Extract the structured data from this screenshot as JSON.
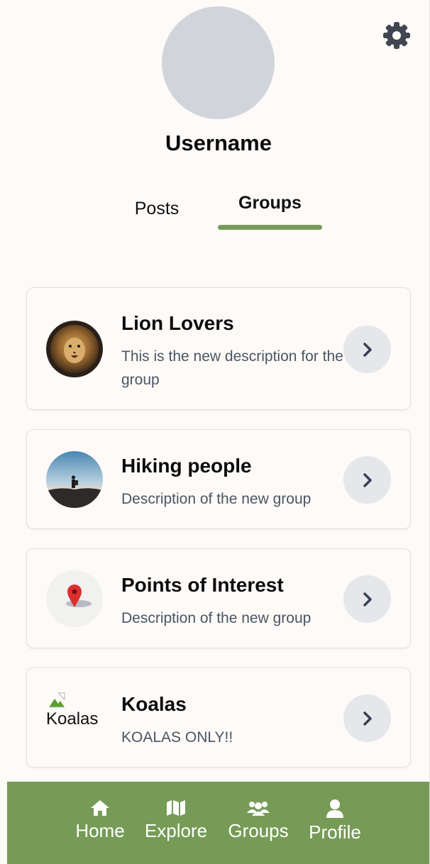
{
  "profile": {
    "username": "Username"
  },
  "tabs": [
    {
      "label": "Posts",
      "active": false
    },
    {
      "label": "Groups",
      "active": true
    }
  ],
  "groups": [
    {
      "name": "Lion Lovers",
      "description": "This is the new description for the group",
      "thumbnail": "lion-photo"
    },
    {
      "name": "Hiking people",
      "description": "Description of the new group",
      "thumbnail": "hiker-photo"
    },
    {
      "name": "Points of Interest",
      "description": "Description of the new group",
      "thumbnail": "map-pin-icon"
    },
    {
      "name": "Koalas",
      "description": "KOALAS ONLY!!",
      "thumbnail_alt": "Koalas"
    }
  ],
  "nav": [
    {
      "label": "Home",
      "icon": "home-icon"
    },
    {
      "label": "Explore",
      "icon": "map-icon"
    },
    {
      "label": "Groups",
      "icon": "users-icon"
    },
    {
      "label": "Profile",
      "icon": "user-icon"
    }
  ],
  "colors": {
    "accent": "#769b57",
    "background": "#fdfaf8",
    "avatar_placeholder": "#d1d5db",
    "chevron_button": "#e5e7eb",
    "description_text": "#4b5563"
  }
}
